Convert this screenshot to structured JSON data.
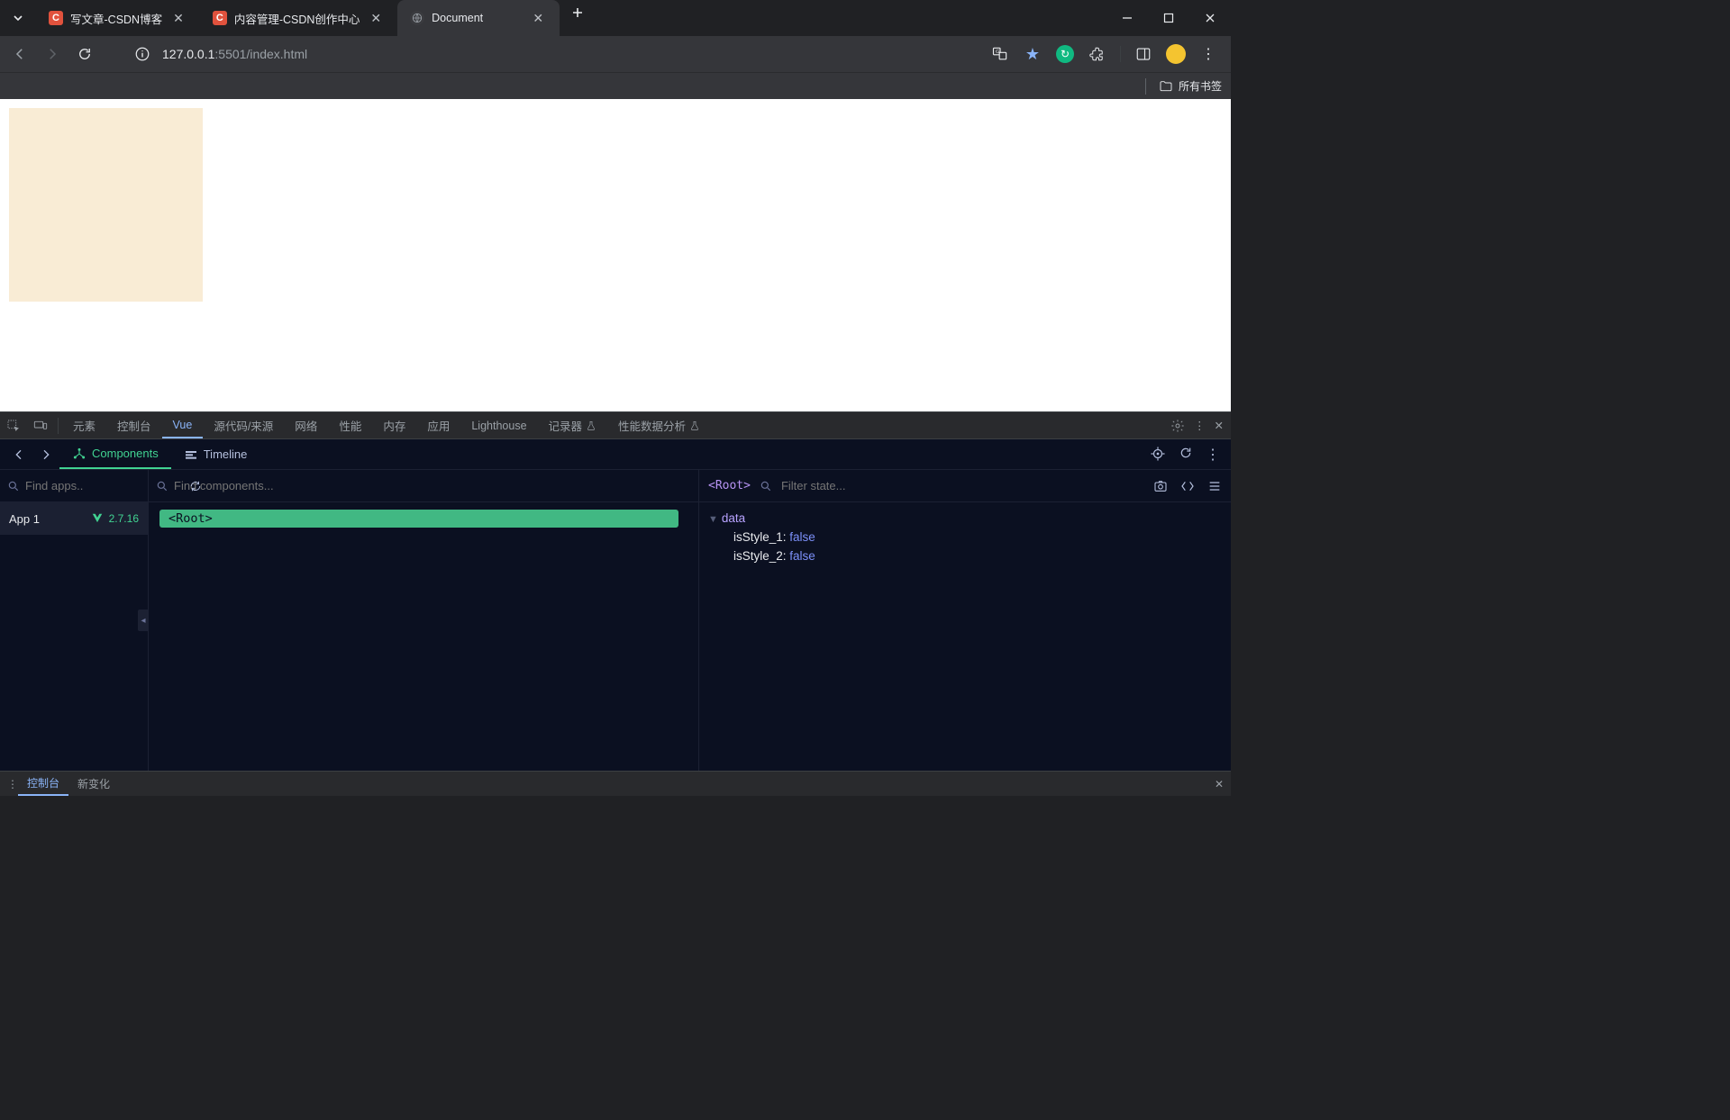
{
  "tabs": [
    {
      "label": "写文章-CSDN博客",
      "fav": "C"
    },
    {
      "label": "内容管理-CSDN创作中心",
      "fav": "C"
    },
    {
      "label": "Document",
      "fav": "globe",
      "active": true
    }
  ],
  "url": {
    "host": "127.0.0.1",
    "port": ":5501",
    "path": "/index.html"
  },
  "bookmarks_label": "所有书签",
  "devtools_tabs": {
    "elements": "元素",
    "console": "控制台",
    "vue": "Vue",
    "sources": "源代码/来源",
    "network": "网络",
    "performance": "性能",
    "memory": "内存",
    "application": "应用",
    "lighthouse": "Lighthouse",
    "recorder": "记录器",
    "perf_insights": "性能数据分析"
  },
  "vue_tabs": {
    "components": "Components",
    "timeline": "Timeline"
  },
  "apps_search_placeholder": "Find apps..",
  "components_search_placeholder": "Find components...",
  "state_search_placeholder": "Filter state...",
  "app": {
    "name": "App 1",
    "version": "2.7.16"
  },
  "root_node": "<Root>",
  "state_crumb": "<Root>",
  "state": {
    "section": "data",
    "props": [
      {
        "key": "isStyle_1",
        "value": "false"
      },
      {
        "key": "isStyle_2",
        "value": "false"
      }
    ]
  },
  "drawer_tabs": {
    "console": "控制台",
    "whatsnew": "新变化"
  }
}
